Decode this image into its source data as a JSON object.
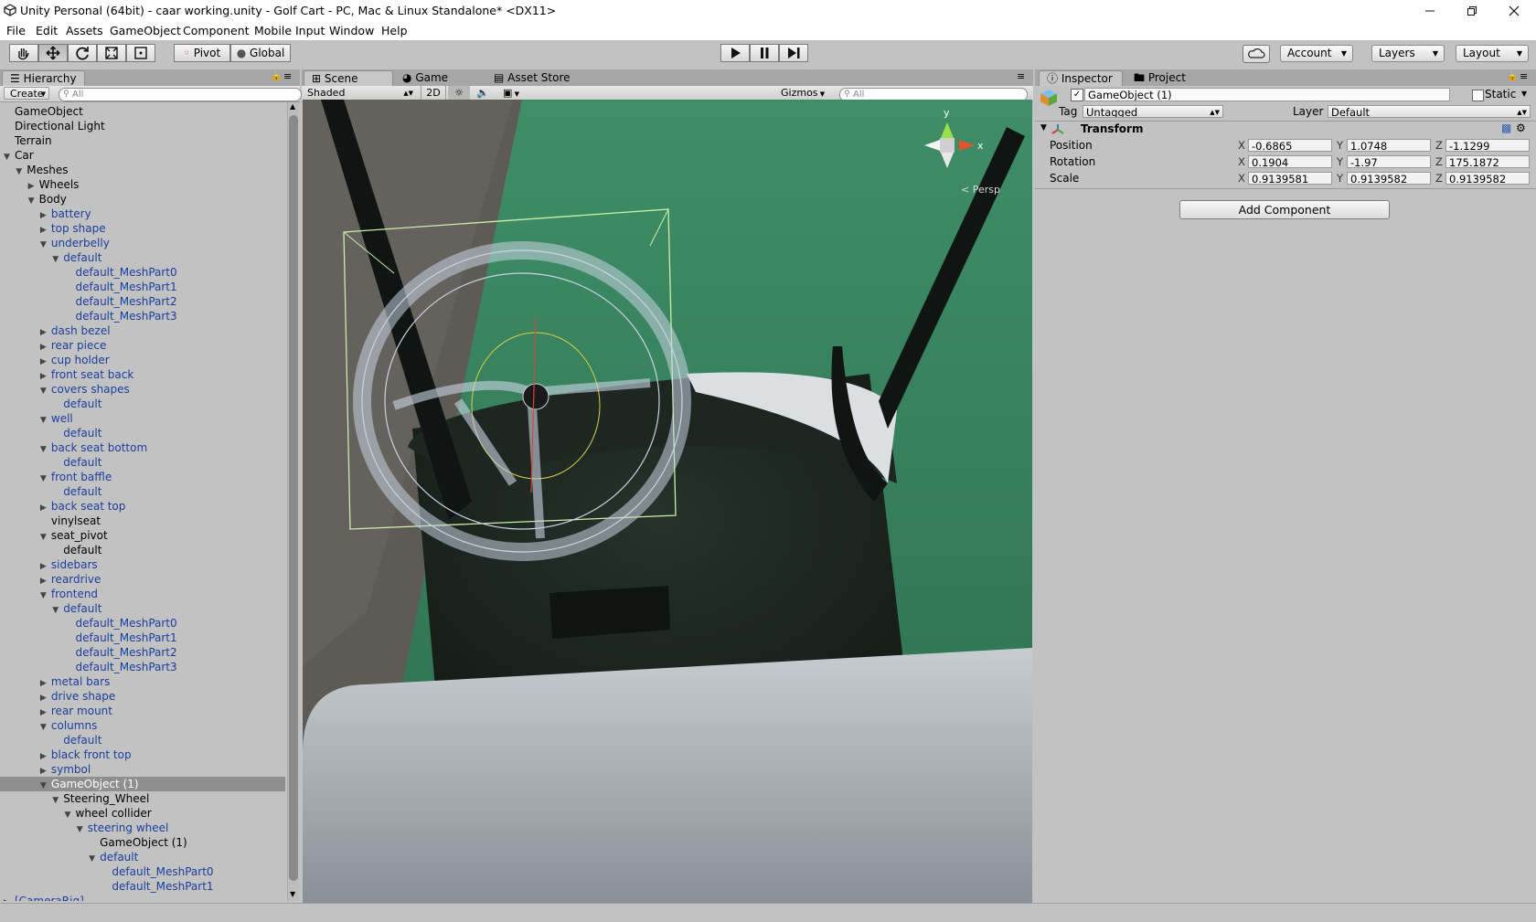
{
  "window": {
    "title": "Unity Personal (64bit) - caar working.unity - Golf Cart - PC, Mac & Linux Standalone* <DX11>",
    "controls": [
      "minimize",
      "restore",
      "close"
    ]
  },
  "menu": [
    "File",
    "Edit",
    "Assets",
    "GameObject",
    "Component",
    "Mobile Input",
    "Window",
    "Help"
  ],
  "toolbar": {
    "tools": [
      "hand-tool",
      "move-tool",
      "rotate-tool",
      "scale-tool",
      "rect-tool"
    ],
    "pivot_label": "Pivot",
    "global_label": "Global",
    "play": [
      "play",
      "pause",
      "step"
    ],
    "account_label": "Account",
    "layers_label": "Layers",
    "layout_label": "Layout"
  },
  "hierarchy": {
    "tab": "Hierarchy",
    "create_label": "Create",
    "search_placeholder": "All",
    "rows": [
      {
        "label": "GameObject",
        "depth": 0,
        "expander": "none",
        "prefab": false
      },
      {
        "label": "Directional Light",
        "depth": 0,
        "expander": "none",
        "prefab": false
      },
      {
        "label": "Terrain",
        "depth": 0,
        "expander": "none",
        "prefab": false
      },
      {
        "label": "Car",
        "depth": 0,
        "expander": "open",
        "prefab": false
      },
      {
        "label": "Meshes",
        "depth": 1,
        "expander": "open",
        "prefab": false
      },
      {
        "label": "Wheels",
        "depth": 2,
        "expander": "closed",
        "prefab": false
      },
      {
        "label": "Body",
        "depth": 2,
        "expander": "open",
        "prefab": false
      },
      {
        "label": "battery",
        "depth": 3,
        "expander": "closed",
        "prefab": true
      },
      {
        "label": "top shape",
        "depth": 3,
        "expander": "closed",
        "prefab": true
      },
      {
        "label": "underbelly",
        "depth": 3,
        "expander": "open",
        "prefab": true
      },
      {
        "label": "default",
        "depth": 4,
        "expander": "open",
        "prefab": true
      },
      {
        "label": "default_MeshPart0",
        "depth": 5,
        "expander": "none",
        "prefab": true
      },
      {
        "label": "default_MeshPart1",
        "depth": 5,
        "expander": "none",
        "prefab": true
      },
      {
        "label": "default_MeshPart2",
        "depth": 5,
        "expander": "none",
        "prefab": true
      },
      {
        "label": "default_MeshPart3",
        "depth": 5,
        "expander": "none",
        "prefab": true
      },
      {
        "label": "dash bezel",
        "depth": 3,
        "expander": "closed",
        "prefab": true
      },
      {
        "label": "rear piece",
        "depth": 3,
        "expander": "closed",
        "prefab": true
      },
      {
        "label": "cup holder",
        "depth": 3,
        "expander": "closed",
        "prefab": true
      },
      {
        "label": "front seat back",
        "depth": 3,
        "expander": "closed",
        "prefab": true
      },
      {
        "label": "covers shapes",
        "depth": 3,
        "expander": "open",
        "prefab": true
      },
      {
        "label": "default",
        "depth": 4,
        "expander": "none",
        "prefab": true
      },
      {
        "label": "well",
        "depth": 3,
        "expander": "open",
        "prefab": true
      },
      {
        "label": "default",
        "depth": 4,
        "expander": "none",
        "prefab": true
      },
      {
        "label": "back seat bottom",
        "depth": 3,
        "expander": "open",
        "prefab": true
      },
      {
        "label": "default",
        "depth": 4,
        "expander": "none",
        "prefab": true
      },
      {
        "label": "front baffle",
        "depth": 3,
        "expander": "open",
        "prefab": true
      },
      {
        "label": "default",
        "depth": 4,
        "expander": "none",
        "prefab": true
      },
      {
        "label": "back seat top",
        "depth": 3,
        "expander": "closed",
        "prefab": true
      },
      {
        "label": "vinylseat",
        "depth": 3,
        "expander": "none",
        "prefab": false
      },
      {
        "label": "seat_pivot",
        "depth": 3,
        "expander": "open",
        "prefab": false
      },
      {
        "label": "default",
        "depth": 4,
        "expander": "none",
        "prefab": false
      },
      {
        "label": "sidebars",
        "depth": 3,
        "expander": "closed",
        "prefab": true
      },
      {
        "label": "reardrive",
        "depth": 3,
        "expander": "closed",
        "prefab": true
      },
      {
        "label": "frontend",
        "depth": 3,
        "expander": "open",
        "prefab": true
      },
      {
        "label": "default",
        "depth": 4,
        "expander": "open",
        "prefab": true
      },
      {
        "label": "default_MeshPart0",
        "depth": 5,
        "expander": "none",
        "prefab": true
      },
      {
        "label": "default_MeshPart1",
        "depth": 5,
        "expander": "none",
        "prefab": true
      },
      {
        "label": "default_MeshPart2",
        "depth": 5,
        "expander": "none",
        "prefab": true
      },
      {
        "label": "default_MeshPart3",
        "depth": 5,
        "expander": "none",
        "prefab": true
      },
      {
        "label": "metal bars",
        "depth": 3,
        "expander": "closed",
        "prefab": true
      },
      {
        "label": "drive shape",
        "depth": 3,
        "expander": "closed",
        "prefab": true
      },
      {
        "label": "rear mount",
        "depth": 3,
        "expander": "closed",
        "prefab": true
      },
      {
        "label": "columns",
        "depth": 3,
        "expander": "open",
        "prefab": true
      },
      {
        "label": "default",
        "depth": 4,
        "expander": "none",
        "prefab": true
      },
      {
        "label": "black front top",
        "depth": 3,
        "expander": "closed",
        "prefab": true
      },
      {
        "label": "symbol",
        "depth": 3,
        "expander": "closed",
        "prefab": true
      },
      {
        "label": "GameObject (1)",
        "depth": 3,
        "expander": "open",
        "prefab": false,
        "selected": true
      },
      {
        "label": "Steering_Wheel",
        "depth": 4,
        "expander": "open",
        "prefab": false
      },
      {
        "label": "wheel collider",
        "depth": 5,
        "expander": "open",
        "prefab": false
      },
      {
        "label": "steering wheel",
        "depth": 6,
        "expander": "open",
        "prefab": true
      },
      {
        "label": "GameObject (1)",
        "depth": 7,
        "expander": "none",
        "prefab": false
      },
      {
        "label": "default",
        "depth": 7,
        "expander": "open",
        "prefab": true
      },
      {
        "label": "default_MeshPart0",
        "depth": 8,
        "expander": "none",
        "prefab": true
      },
      {
        "label": "default_MeshPart1",
        "depth": 8,
        "expander": "none",
        "prefab": true
      },
      {
        "label": "[CameraRig]",
        "depth": 0,
        "expander": "closed",
        "prefab": true
      }
    ]
  },
  "scene": {
    "tabs": [
      "Scene",
      "Game",
      "Asset Store"
    ],
    "shading_mode": "Shaded",
    "mode_2d": "2D",
    "gizmos_label": "Gizmos",
    "search_placeholder": "All",
    "projection_label": "< Persp",
    "axis_labels": {
      "y": "y",
      "x": "x"
    }
  },
  "inspector": {
    "tabs": [
      "Inspector",
      "Project"
    ],
    "object_name": "GameObject (1)",
    "active": true,
    "static_label": "Static",
    "tag_label": "Tag",
    "tag_value": "Untagged",
    "layer_label": "Layer",
    "layer_value": "Default",
    "component_title": "Transform",
    "position_label": "Position",
    "rotation_label": "Rotation",
    "scale_label": "Scale",
    "position": {
      "x": "-0.6865",
      "y": "1.0748",
      "z": "-1.1299"
    },
    "rotation": {
      "x": "0.1904",
      "y": "-1.97",
      "z": "175.1872"
    },
    "scale": {
      "x": "0.9139581",
      "y": "0.9139582",
      "z": "0.9139582"
    },
    "axis_names": {
      "x": "X",
      "y": "Y",
      "z": "Z"
    },
    "add_component_label": "Add Component"
  }
}
